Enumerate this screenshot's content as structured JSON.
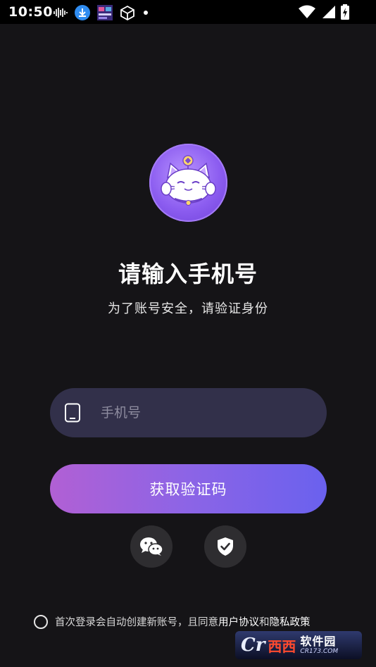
{
  "status_bar": {
    "time": "10:50",
    "icons_left": [
      "sound-wave-icon",
      "download-icon",
      "app-thumbnail-icon",
      "cube-icon",
      "dot-icon"
    ],
    "icons_right": [
      "wifi-icon",
      "signal-icon",
      "battery-charging-icon"
    ]
  },
  "logo": {
    "name": "lucky-cat-logo"
  },
  "header": {
    "title": "请输入手机号",
    "subtitle": "为了账号安全，请验证身份"
  },
  "phone_input": {
    "placeholder": "手机号",
    "value": "",
    "icon": "phone-icon"
  },
  "get_code_button": {
    "label": "获取验证码"
  },
  "social_login": [
    {
      "icon": "wechat-icon"
    },
    {
      "icon": "shield-check-icon"
    }
  ],
  "agreement": {
    "checked": false,
    "text": "首次登录会自动创建新账号，且同意",
    "user_agreement": "用户协议",
    "conjunction": "和",
    "privacy_policy": "隐私政策"
  },
  "watermark": {
    "logo": "Cr",
    "site": "西西",
    "name": "软件园",
    "url": "CR173.COM"
  },
  "colors": {
    "background": "#151417",
    "input_bg": "#32304a",
    "button_gradient_start": "#b160d4",
    "button_gradient_end": "#6a61ee",
    "social_bg": "#2e2d30"
  }
}
